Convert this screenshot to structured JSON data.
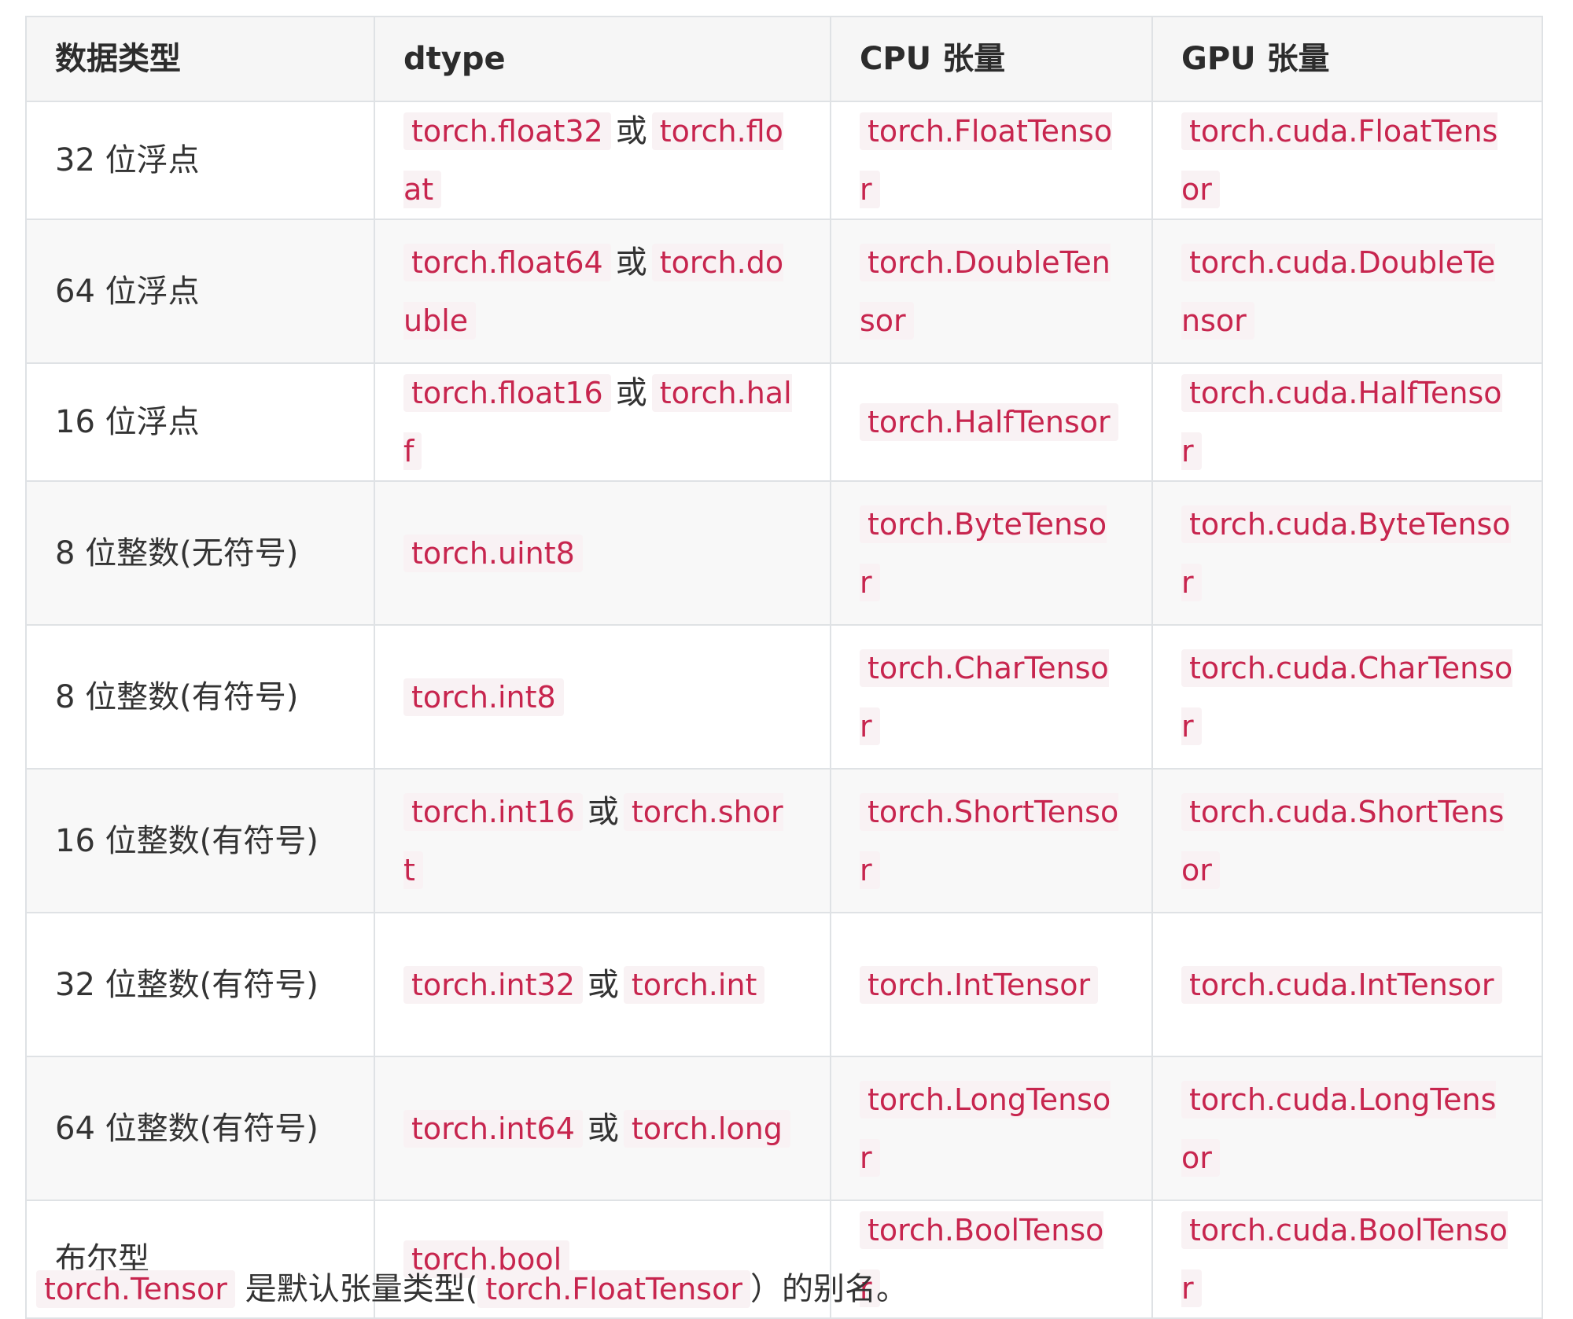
{
  "table": {
    "headers": [
      "数据类型",
      "dtype",
      "CPU 张量",
      "GPU 张量"
    ],
    "rows": [
      {
        "type": "32 位浮点",
        "dtype": [
          "torch.float32",
          "torch.float"
        ],
        "cpu": "torch.FloatTensor",
        "gpu": "torch.cuda.FloatTensor"
      },
      {
        "type": "64 位浮点",
        "dtype": [
          "torch.float64",
          "torch.double"
        ],
        "cpu": "torch.DoubleTensor",
        "gpu": "torch.cuda.DoubleTensor"
      },
      {
        "type": "16 位浮点",
        "dtype": [
          "torch.float16",
          "torch.half"
        ],
        "cpu": "torch.HalfTensor",
        "gpu": "torch.cuda.HalfTensor"
      },
      {
        "type": "8 位整数(无符号)",
        "dtype": [
          "torch.uint8"
        ],
        "cpu": "torch.ByteTensor",
        "gpu": "torch.cuda.ByteTensor"
      },
      {
        "type": "8 位整数(有符号)",
        "dtype": [
          "torch.int8"
        ],
        "cpu": "torch.CharTensor",
        "gpu": "torch.cuda.CharTensor"
      },
      {
        "type": "16 位整数(有符号)",
        "dtype": [
          "torch.int16",
          "torch.short"
        ],
        "cpu": "torch.ShortTensor",
        "gpu": "torch.cuda.ShortTensor"
      },
      {
        "type": "32 位整数(有符号)",
        "dtype": [
          "torch.int32",
          "torch.int"
        ],
        "cpu": "torch.IntTensor",
        "gpu": "torch.cuda.IntTensor"
      },
      {
        "type": "64 位整数(有符号)",
        "dtype": [
          "torch.int64",
          "torch.long"
        ],
        "cpu": "torch.LongTensor",
        "gpu": "torch.cuda.LongTensor"
      },
      {
        "type": "布尔型",
        "dtype": [
          "torch.bool"
        ],
        "cpu": "torch.BoolTensor",
        "gpu": "torch.cuda.BoolTensor"
      }
    ],
    "or_word": "或"
  },
  "footer": {
    "code1": "torch.Tensor",
    "text1": " 是默认张量类型(",
    "code2": "torch.FloatTensor",
    "text2": "）的别名。"
  }
}
